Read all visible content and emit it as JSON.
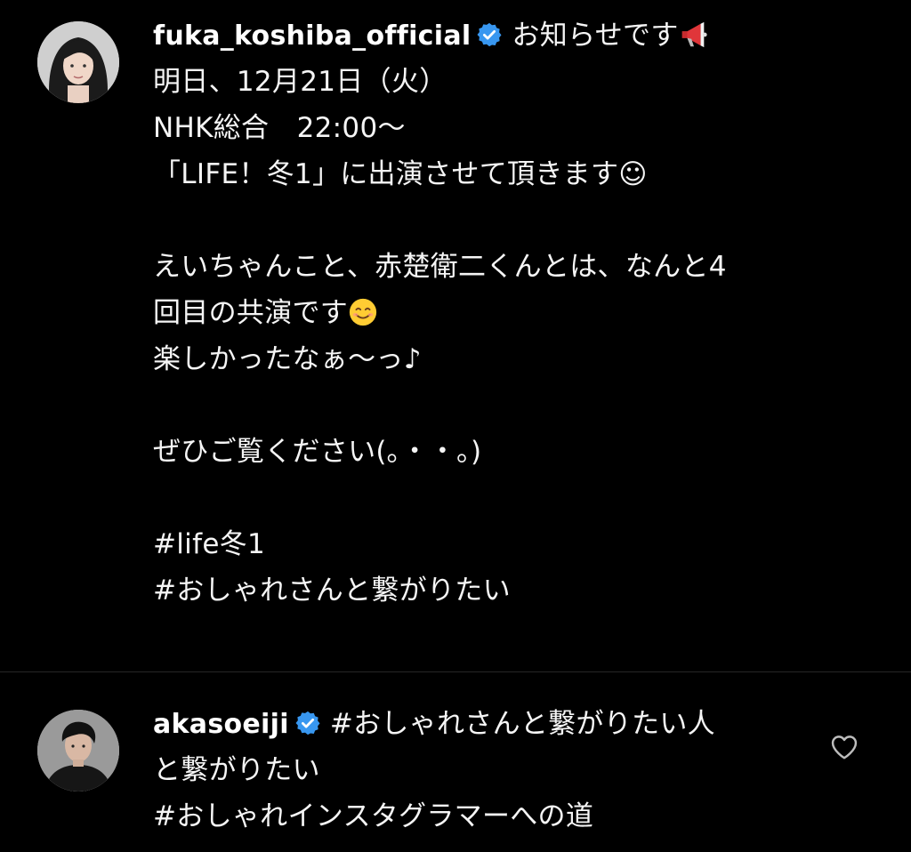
{
  "post": {
    "username": "fuka_koshiba_official",
    "lines": [
      "お知らせです",
      "明日、12月21日（火）",
      "NHK総合　22:00〜",
      "「LIFE！冬1」に出演させて頂きます☺",
      "",
      "えいちゃんこと、赤楚衛二くんとは、なんと4",
      "回目の共演です",
      "楽しかったなぁ〜っ♪",
      "",
      "ぜひご覧ください(｡・・｡)",
      "",
      "#life冬1",
      "#おしゃれさんと繋がりたい"
    ],
    "icons": {
      "verified": "verified-badge-icon",
      "megaphone": "megaphone-emoji-icon",
      "smile": "smiling-face-emoji-icon"
    }
  },
  "reply": {
    "username": "akasoeiji",
    "lines": [
      "#おしゃれさんと繋がりたい人",
      "と繋がりたい",
      "#おしゃれインスタグラマーへの道"
    ],
    "icons": {
      "verified": "verified-badge-icon",
      "like": "heart-outline-icon"
    }
  },
  "colors": {
    "background": "#000000",
    "text": "#f5f5f5",
    "verified": "#3897f0",
    "divider": "#262626"
  }
}
